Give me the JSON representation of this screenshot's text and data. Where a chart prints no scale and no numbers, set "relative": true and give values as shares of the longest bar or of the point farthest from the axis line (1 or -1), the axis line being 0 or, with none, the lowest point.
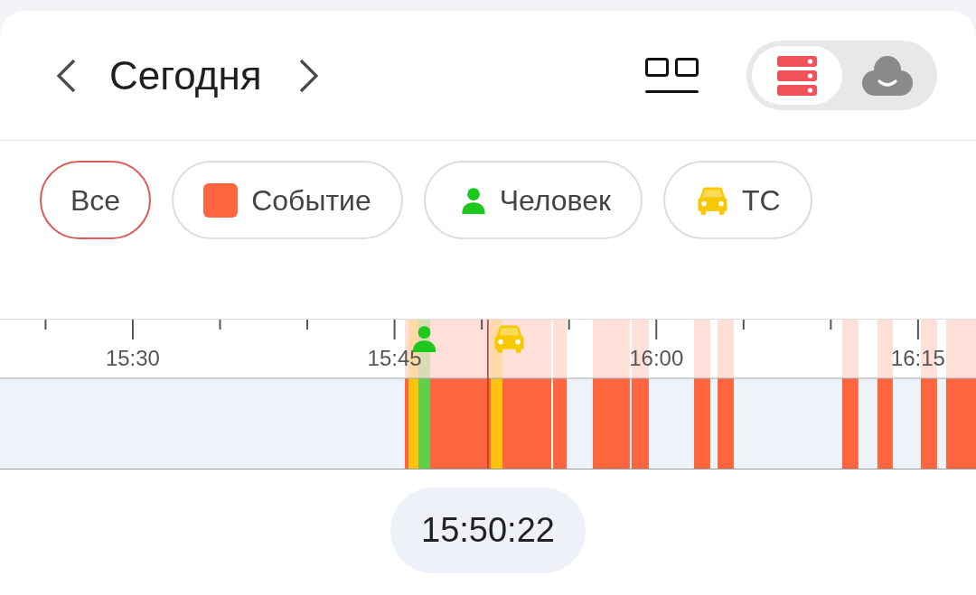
{
  "header": {
    "title": "Сегодня"
  },
  "view_toggle": [
    {
      "kind": "device",
      "selected": true
    },
    {
      "kind": "cloud",
      "selected": false
    }
  ],
  "filters": [
    {
      "kind": "all",
      "label": "Все",
      "selected": true
    },
    {
      "kind": "event",
      "label": "Событие",
      "selected": false,
      "color": "#ff6640"
    },
    {
      "kind": "person",
      "label": "Человек",
      "selected": false,
      "color": "#1bc81b"
    },
    {
      "kind": "vehicle",
      "label": "ТС",
      "selected": false,
      "color": "#f8c800"
    }
  ],
  "timeline": {
    "markers": [
      {
        "kind": "person",
        "color": "#1bc81b"
      },
      {
        "kind": "vehicle",
        "color": "#f8c800"
      }
    ],
    "chart_data": {
      "type": "area",
      "relative": true,
      "xlim": [
        922.39,
        978.32
      ],
      "xticks": [
        {
          "value": 930,
          "label": "15:30"
        },
        {
          "value": 945,
          "label": "15:45"
        },
        {
          "value": 960,
          "label": "16:00"
        },
        {
          "value": 975,
          "label": "16:15"
        }
      ],
      "x": [
        922.39,
        945.59,
        945.59,
        953.98,
        953.98,
        954.08,
        954.08,
        954.86,
        954.86,
        956.36,
        956.36,
        958.48,
        958.48,
        958.59,
        958.59,
        959.57,
        959.57,
        962.16,
        962.16,
        963.09,
        963.09,
        963.51,
        963.51,
        964.44,
        964.44,
        970.65,
        970.65,
        971.58,
        971.58,
        972.67,
        972.67,
        973.55,
        973.55,
        975.16,
        975.16,
        976.09,
        976.09,
        976.61,
        976.61,
        978.32
      ],
      "series": [
        {
          "color": "#ff6640",
          "values": [
            0,
            0,
            1,
            1,
            0,
            0,
            1,
            1,
            0,
            0,
            1,
            1,
            0,
            0,
            1,
            1,
            0,
            0,
            1,
            1,
            0,
            0,
            1,
            1,
            0,
            0,
            1,
            1,
            0,
            0,
            1,
            1,
            0,
            0,
            1,
            1,
            0,
            0,
            1,
            1
          ]
        }
      ],
      "bands": [
        {
          "axis": "x",
          "from": 946.37,
          "to": 947.04,
          "color": "#5fcf4a"
        },
        {
          "axis": "x",
          "from": 950.51,
          "to": 951.18,
          "color": "#ffc20e"
        },
        {
          "axis": "x",
          "from": 945.8,
          "to": 946.37,
          "color": "#ffc20e"
        }
      ],
      "ref_lines": [
        {
          "axis": "x",
          "value": 950.35,
          "color": "#c0392b"
        }
      ]
    }
  },
  "current_time": "15:50:22"
}
